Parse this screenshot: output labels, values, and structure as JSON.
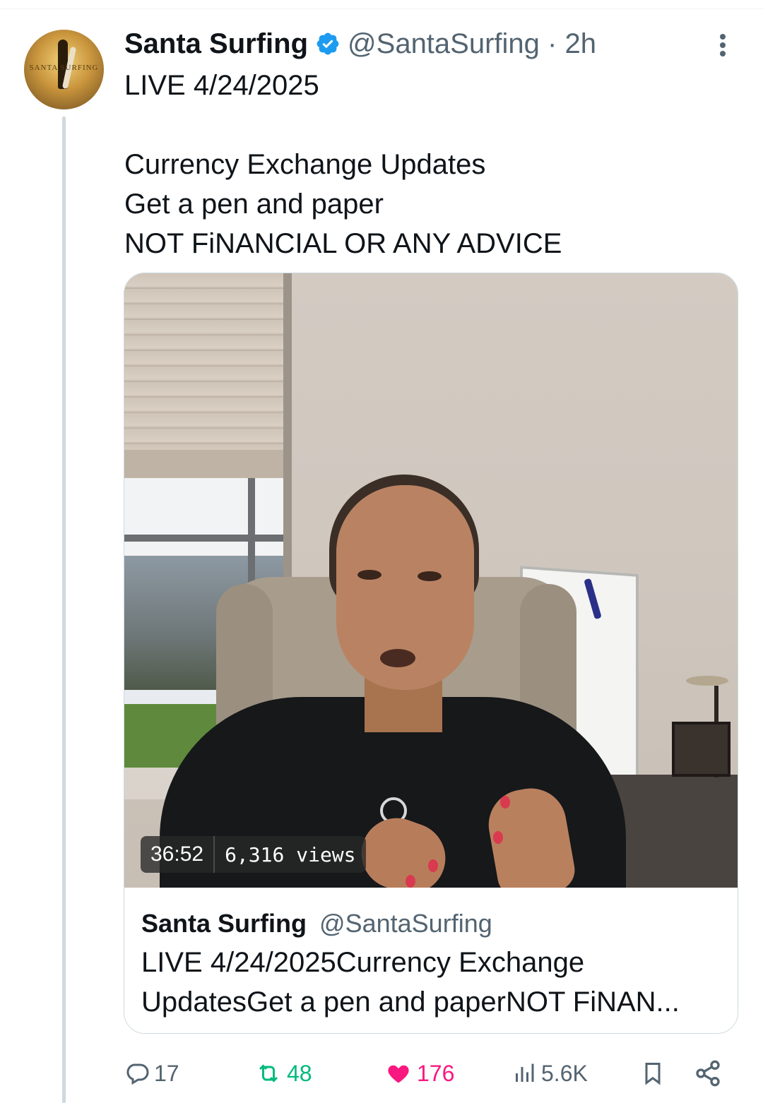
{
  "post": {
    "author_name": "Santa Surfing",
    "handle_time": "@SantaSurfing · 2h",
    "avatar_text": "SANTA SURFING",
    "text_lines": [
      "LIVE 4/24/2025",
      "",
      "Currency Exchange Updates",
      "Get a pen and paper",
      "NOT FiNANCIAL OR ANY ADVICE"
    ]
  },
  "video": {
    "duration": "36:52",
    "views": "6,316 views"
  },
  "card": {
    "author_name": "Santa Surfing",
    "handle": "@SantaSurfing",
    "desc_lines": [
      "LIVE 4/24/2025Currency Exchange",
      "UpdatesGet a pen and paperNOT FiNAN..."
    ]
  },
  "actions": {
    "replies": "17",
    "reposts": "48",
    "likes": "176",
    "views": "5.6K"
  },
  "colors": {
    "verified": "#1d9bf0",
    "repost": "#00ba7c",
    "like": "#f91880",
    "muted": "#536471"
  }
}
